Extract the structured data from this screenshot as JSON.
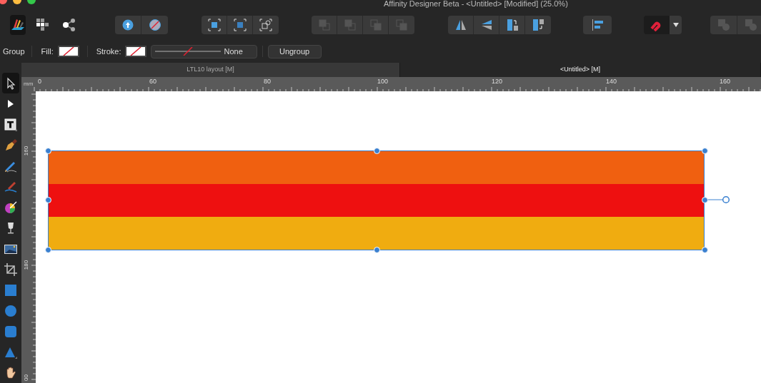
{
  "window": {
    "title": "Affinity Designer Beta - <Untitled> [Modified] (25.0%)"
  },
  "context_bar": {
    "selection": "Group",
    "fill_label": "Fill:",
    "stroke_label": "Stroke:",
    "stroke_style": "None",
    "action": "Ungroup"
  },
  "tabs": [
    {
      "label": "LTL10 layout [M]",
      "selected": false
    },
    {
      "label": "<Untitled> [M]",
      "selected": true
    }
  ],
  "ruler": {
    "unit": "mm",
    "horizontal": [
      "0",
      "60",
      "80",
      "100",
      "120",
      "140",
      "160"
    ],
    "vertical": [
      "160",
      "180",
      "00"
    ]
  },
  "tools": [
    {
      "selected": true
    },
    {
      "selected": false
    },
    {
      "selected": false
    },
    {
      "selected": false
    },
    {
      "selected": false
    },
    {
      "selected": false
    },
    {
      "selected": false
    },
    {
      "selected": false
    },
    {
      "selected": false
    },
    {
      "selected": false
    },
    {
      "selected": false
    },
    {
      "selected": false
    },
    {
      "selected": false
    },
    {
      "selected": false
    },
    {
      "selected": false
    }
  ],
  "canvas": {
    "stripes": [
      {
        "color": "#f06010"
      },
      {
        "color": "#ee1010"
      },
      {
        "color": "#f0ac10"
      }
    ]
  }
}
